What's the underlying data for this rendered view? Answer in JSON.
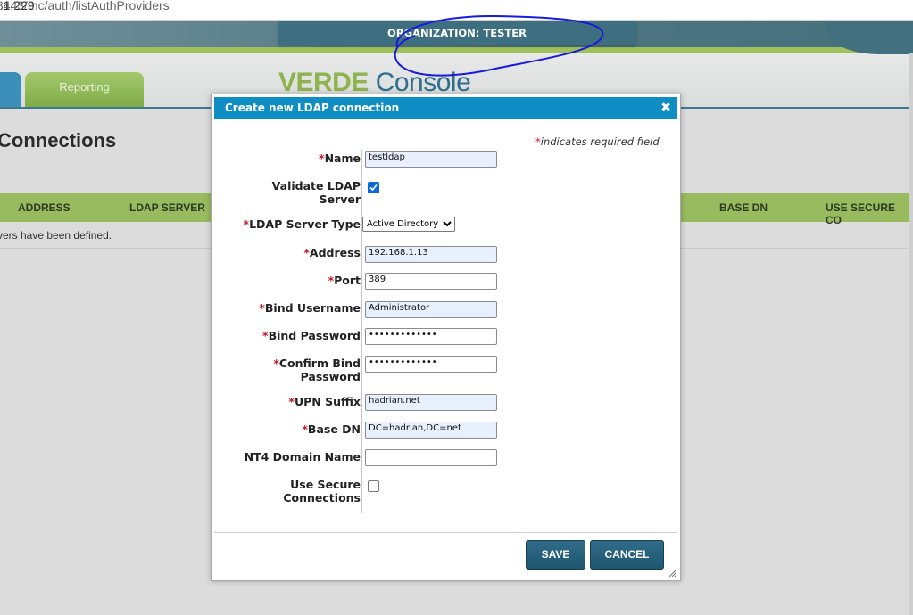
{
  "browser": {
    "url_host": "3.1.229",
    "url_path": ":8443/mc/auth/listAuthProviders"
  },
  "header": {
    "organization": "ORGANIZATION: TESTER",
    "logo_part1": "VERDE",
    "logo_part2": " Console"
  },
  "nav": {
    "tab_reporting": "Reporting"
  },
  "page": {
    "title": "Connections",
    "columns": [
      "ADDRESS",
      "LDAP SERVER",
      "BASE DN",
      "USE SECURE CO"
    ],
    "empty_message": "vers have been defined."
  },
  "dialog": {
    "title": "Create new LDAP connection",
    "required_note": "indicates required field",
    "required_star": "*",
    "fields": {
      "name": {
        "label": "Name",
        "value": "testldap"
      },
      "validate": {
        "label1": "Validate LDAP",
        "label2": "Server",
        "checked": true
      },
      "server_type": {
        "label": "LDAP Server Type",
        "value": "Active Directory"
      },
      "address": {
        "label": "Address",
        "value": "192.168.1.13"
      },
      "port": {
        "label": "Port",
        "value": "389"
      },
      "bind_username": {
        "label": "Bind Username",
        "value": "Administrator"
      },
      "bind_password": {
        "label": "Bind Password",
        "value": "•••••••••••••"
      },
      "confirm_bind": {
        "label1": "Confirm Bind",
        "label2": "Password",
        "value": "•••••••••••••"
      },
      "upn_suffix": {
        "label": "UPN Suffix",
        "value": "hadrian.net"
      },
      "base_dn": {
        "label": "Base DN",
        "value": "DC=hadrian,DC=net"
      },
      "nt4_domain": {
        "label": "NT4 Domain Name",
        "value": ""
      },
      "secure": {
        "label1": "Use Secure",
        "label2": "Connections",
        "checked": false
      }
    },
    "save_label": "SAVE",
    "cancel_label": "CANCEL"
  },
  "colors": {
    "accent": "#0f8ec3",
    "button": "#1f5670",
    "green": "#98bb5f",
    "required": "#c0192b"
  }
}
